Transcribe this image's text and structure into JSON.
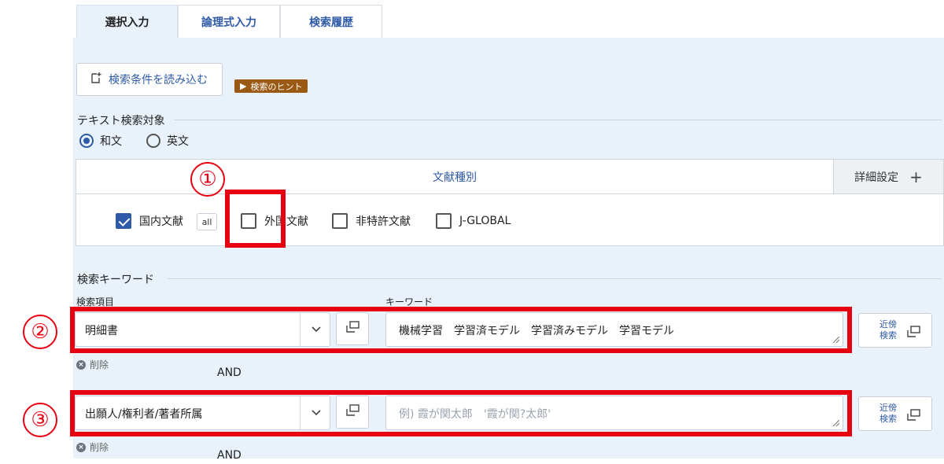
{
  "tabs": [
    {
      "label": "選択入力",
      "active": true
    },
    {
      "label": "論理式入力",
      "active": false
    },
    {
      "label": "検索履歴",
      "active": false
    }
  ],
  "toolbar": {
    "load_label": "検索条件を読み込む",
    "hint_label": "検索のヒント"
  },
  "text_target": {
    "label": "テキスト検索対象",
    "options": [
      {
        "label": "和文",
        "selected": true
      },
      {
        "label": "英文",
        "selected": false
      }
    ]
  },
  "doc_types": {
    "header": "文献種別",
    "detail_label": "詳細設定",
    "items": [
      {
        "label": "国内文献",
        "checked": true
      },
      {
        "label": "外国文献",
        "checked": false
      },
      {
        "label": "非特許文献",
        "checked": false
      },
      {
        "label": "J-GLOBAL",
        "checked": false
      }
    ],
    "all_badge": "all"
  },
  "keyword_section": {
    "label": "検索キーワード",
    "col_item": "検索項目",
    "col_keyword": "キーワード",
    "rows": [
      {
        "field": "明細書",
        "keyword": "機械学習　学習済モデル　学習済みモデル　学習モデル",
        "placeholder": "",
        "near_label": "近傍検索",
        "delete_label": "削除",
        "operator": "AND"
      },
      {
        "field": "出願人/権利者/著者所属",
        "keyword": "",
        "placeholder": "例) 霞が関太郎　'霞が関?太郎'",
        "near_label": "近傍検索",
        "delete_label": "削除",
        "operator": "AND"
      }
    ]
  },
  "annotations": [
    "①",
    "②",
    "③"
  ],
  "colors": {
    "accent": "#2f5aa8",
    "panel_bg": "#e9f2fa",
    "hint_bg": "#9a5a14",
    "annotation": "#e60012"
  }
}
